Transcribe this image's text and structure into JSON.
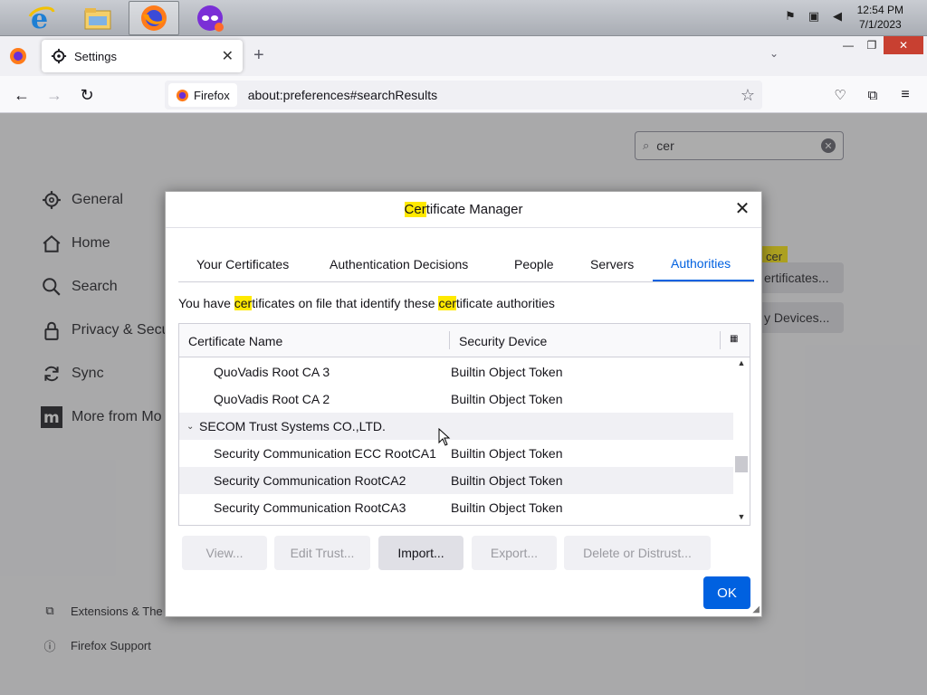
{
  "taskbar": {
    "apps": [
      {
        "name": "internet-explorer",
        "active": false
      },
      {
        "name": "file-explorer",
        "active": false
      },
      {
        "name": "firefox",
        "active": true
      },
      {
        "name": "private-browsing",
        "active": false
      }
    ],
    "clock_time": "12:54 PM",
    "clock_date": "7/1/2023"
  },
  "browser": {
    "tab_title": "Settings",
    "identity_label": "Firefox",
    "url": "about:preferences#searchResults"
  },
  "prefs": {
    "search_value": "cer",
    "sidebar": [
      {
        "label": "General",
        "icon": "gear-icon"
      },
      {
        "label": "Home",
        "icon": "home-icon"
      },
      {
        "label": "Search",
        "icon": "search-icon"
      },
      {
        "label": "Privacy & Secu",
        "icon": "lock-icon"
      },
      {
        "label": "Sync",
        "icon": "sync-icon"
      },
      {
        "label": "More from Mo",
        "icon": "mozilla-icon"
      }
    ],
    "footer": [
      {
        "label": "Extensions & The",
        "icon": "puzzle-icon"
      },
      {
        "label": "Firefox Support",
        "icon": "help-icon"
      }
    ],
    "bg_tag": "cer",
    "bg_button_1": "ertificates...",
    "bg_button_2": "y Devices..."
  },
  "dialog": {
    "title_highlight": "Cer",
    "title_rest": "tificate Manager",
    "tabs": [
      "Your Certificates",
      "Authentication Decisions",
      "People",
      "Servers",
      "Authorities"
    ],
    "selected_tab": "Authorities",
    "desc": {
      "part1": "You have ",
      "hl1": "cer",
      "part2": "tificates on file that identify these ",
      "hl2": "cer",
      "part3": "tificate authorities"
    },
    "columns": [
      "Certificate Name",
      "Security Device"
    ],
    "rows": [
      {
        "name": "QuoVadis Root CA 3",
        "device": "Builtin Object Token",
        "group": false
      },
      {
        "name": "QuoVadis Root CA 2",
        "device": "Builtin Object Token",
        "group": false
      },
      {
        "name": "SECOM Trust Systems CO.,LTD.",
        "device": "",
        "group": true
      },
      {
        "name": "Security Communication ECC RootCA1",
        "device": "Builtin Object Token",
        "group": false
      },
      {
        "name": "Security Communication RootCA2",
        "device": "Builtin Object Token",
        "group": false
      },
      {
        "name": "Security Communication RootCA3",
        "device": "Builtin Object Token",
        "group": false
      }
    ],
    "buttons": {
      "view": "View...",
      "edit_trust": "Edit Trust...",
      "import": "Import...",
      "export": "Export...",
      "delete": "Delete or Distrust..."
    },
    "ok": "OK"
  },
  "colors": {
    "accent": "#0061e0",
    "highlight": "#ffe900",
    "close_red": "#c84031"
  }
}
